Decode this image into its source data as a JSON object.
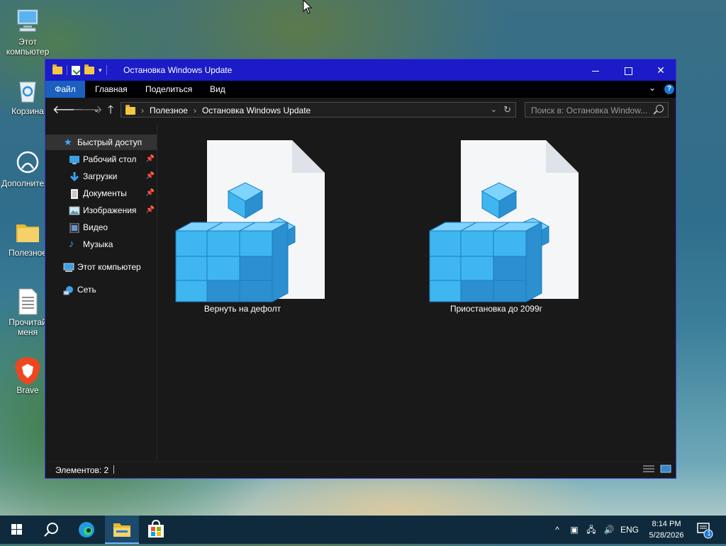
{
  "desktop": {
    "icons": [
      {
        "label": "Этот компьютер",
        "icon": "computer-icon"
      },
      {
        "label": "Корзина",
        "icon": "recycle-bin-icon"
      },
      {
        "label": "Дополнительные сведения",
        "icon": "info-icon"
      },
      {
        "label": "Полезное",
        "icon": "folder-icon"
      },
      {
        "label": "Прочитай меня",
        "icon": "text-file-icon"
      },
      {
        "label": "Brave",
        "icon": "brave-icon"
      }
    ]
  },
  "window": {
    "title": "Остановка Windows Update",
    "ribbon_tabs": [
      "Файл",
      "Главная",
      "Поделиться",
      "Вид"
    ],
    "address": {
      "crumbs": [
        "Полезное",
        "Остановка Windows Update"
      ]
    },
    "search": {
      "placeholder": "Поиск в: Остановка Window..."
    },
    "nav": {
      "quick_access": "Быстрый доступ",
      "items": [
        {
          "label": "Рабочий стол",
          "icon": "desktop-icon",
          "pinned": true
        },
        {
          "label": "Загрузки",
          "icon": "downloads-icon",
          "pinned": true
        },
        {
          "label": "Документы",
          "icon": "documents-icon",
          "pinned": true
        },
        {
          "label": "Изображения",
          "icon": "pictures-icon",
          "pinned": true
        },
        {
          "label": "Видео",
          "icon": "videos-icon",
          "pinned": false
        },
        {
          "label": "Музыка",
          "icon": "music-icon",
          "pinned": false
        }
      ],
      "this_pc": "Этот компьютер",
      "network": "Сеть"
    },
    "files": [
      {
        "name": "Вернуть на дефолт",
        "icon": "registry-file-icon"
      },
      {
        "name": "Приостановка до 2099г",
        "icon": "registry-file-icon"
      }
    ],
    "status": {
      "count": "Элементов: 2"
    }
  },
  "taskbar": {
    "tray": {
      "language": "ENG",
      "time": "8:14 PM",
      "date": "5/28/2026",
      "notifications": "1"
    }
  },
  "colors": {
    "titlebar": "#1b1bc7",
    "file_tab": "#1b5fbf",
    "explorer_bg": "#191919",
    "registry_blue": "#3fb6ef"
  }
}
